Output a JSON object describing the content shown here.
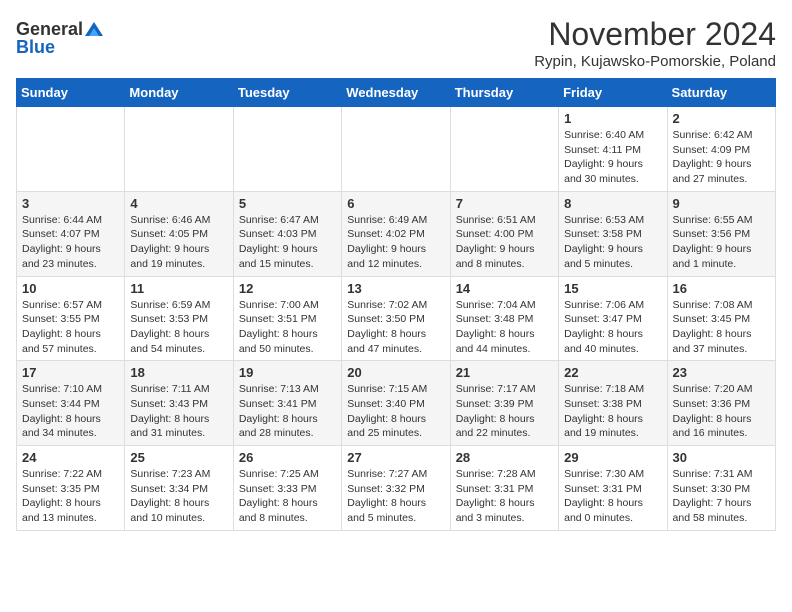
{
  "header": {
    "logo_general": "General",
    "logo_blue": "Blue",
    "month_title": "November 2024",
    "location": "Rypin, Kujawsko-Pomorskie, Poland"
  },
  "weekdays": [
    "Sunday",
    "Monday",
    "Tuesday",
    "Wednesday",
    "Thursday",
    "Friday",
    "Saturday"
  ],
  "weeks": [
    [
      {
        "day": "",
        "info": ""
      },
      {
        "day": "",
        "info": ""
      },
      {
        "day": "",
        "info": ""
      },
      {
        "day": "",
        "info": ""
      },
      {
        "day": "",
        "info": ""
      },
      {
        "day": "1",
        "info": "Sunrise: 6:40 AM\nSunset: 4:11 PM\nDaylight: 9 hours and 30 minutes."
      },
      {
        "day": "2",
        "info": "Sunrise: 6:42 AM\nSunset: 4:09 PM\nDaylight: 9 hours and 27 minutes."
      }
    ],
    [
      {
        "day": "3",
        "info": "Sunrise: 6:44 AM\nSunset: 4:07 PM\nDaylight: 9 hours and 23 minutes."
      },
      {
        "day": "4",
        "info": "Sunrise: 6:46 AM\nSunset: 4:05 PM\nDaylight: 9 hours and 19 minutes."
      },
      {
        "day": "5",
        "info": "Sunrise: 6:47 AM\nSunset: 4:03 PM\nDaylight: 9 hours and 15 minutes."
      },
      {
        "day": "6",
        "info": "Sunrise: 6:49 AM\nSunset: 4:02 PM\nDaylight: 9 hours and 12 minutes."
      },
      {
        "day": "7",
        "info": "Sunrise: 6:51 AM\nSunset: 4:00 PM\nDaylight: 9 hours and 8 minutes."
      },
      {
        "day": "8",
        "info": "Sunrise: 6:53 AM\nSunset: 3:58 PM\nDaylight: 9 hours and 5 minutes."
      },
      {
        "day": "9",
        "info": "Sunrise: 6:55 AM\nSunset: 3:56 PM\nDaylight: 9 hours and 1 minute."
      }
    ],
    [
      {
        "day": "10",
        "info": "Sunrise: 6:57 AM\nSunset: 3:55 PM\nDaylight: 8 hours and 57 minutes."
      },
      {
        "day": "11",
        "info": "Sunrise: 6:59 AM\nSunset: 3:53 PM\nDaylight: 8 hours and 54 minutes."
      },
      {
        "day": "12",
        "info": "Sunrise: 7:00 AM\nSunset: 3:51 PM\nDaylight: 8 hours and 50 minutes."
      },
      {
        "day": "13",
        "info": "Sunrise: 7:02 AM\nSunset: 3:50 PM\nDaylight: 8 hours and 47 minutes."
      },
      {
        "day": "14",
        "info": "Sunrise: 7:04 AM\nSunset: 3:48 PM\nDaylight: 8 hours and 44 minutes."
      },
      {
        "day": "15",
        "info": "Sunrise: 7:06 AM\nSunset: 3:47 PM\nDaylight: 8 hours and 40 minutes."
      },
      {
        "day": "16",
        "info": "Sunrise: 7:08 AM\nSunset: 3:45 PM\nDaylight: 8 hours and 37 minutes."
      }
    ],
    [
      {
        "day": "17",
        "info": "Sunrise: 7:10 AM\nSunset: 3:44 PM\nDaylight: 8 hours and 34 minutes."
      },
      {
        "day": "18",
        "info": "Sunrise: 7:11 AM\nSunset: 3:43 PM\nDaylight: 8 hours and 31 minutes."
      },
      {
        "day": "19",
        "info": "Sunrise: 7:13 AM\nSunset: 3:41 PM\nDaylight: 8 hours and 28 minutes."
      },
      {
        "day": "20",
        "info": "Sunrise: 7:15 AM\nSunset: 3:40 PM\nDaylight: 8 hours and 25 minutes."
      },
      {
        "day": "21",
        "info": "Sunrise: 7:17 AM\nSunset: 3:39 PM\nDaylight: 8 hours and 22 minutes."
      },
      {
        "day": "22",
        "info": "Sunrise: 7:18 AM\nSunset: 3:38 PM\nDaylight: 8 hours and 19 minutes."
      },
      {
        "day": "23",
        "info": "Sunrise: 7:20 AM\nSunset: 3:36 PM\nDaylight: 8 hours and 16 minutes."
      }
    ],
    [
      {
        "day": "24",
        "info": "Sunrise: 7:22 AM\nSunset: 3:35 PM\nDaylight: 8 hours and 13 minutes."
      },
      {
        "day": "25",
        "info": "Sunrise: 7:23 AM\nSunset: 3:34 PM\nDaylight: 8 hours and 10 minutes."
      },
      {
        "day": "26",
        "info": "Sunrise: 7:25 AM\nSunset: 3:33 PM\nDaylight: 8 hours and 8 minutes."
      },
      {
        "day": "27",
        "info": "Sunrise: 7:27 AM\nSunset: 3:32 PM\nDaylight: 8 hours and 5 minutes."
      },
      {
        "day": "28",
        "info": "Sunrise: 7:28 AM\nSunset: 3:31 PM\nDaylight: 8 hours and 3 minutes."
      },
      {
        "day": "29",
        "info": "Sunrise: 7:30 AM\nSunset: 3:31 PM\nDaylight: 8 hours and 0 minutes."
      },
      {
        "day": "30",
        "info": "Sunrise: 7:31 AM\nSunset: 3:30 PM\nDaylight: 7 hours and 58 minutes."
      }
    ]
  ]
}
